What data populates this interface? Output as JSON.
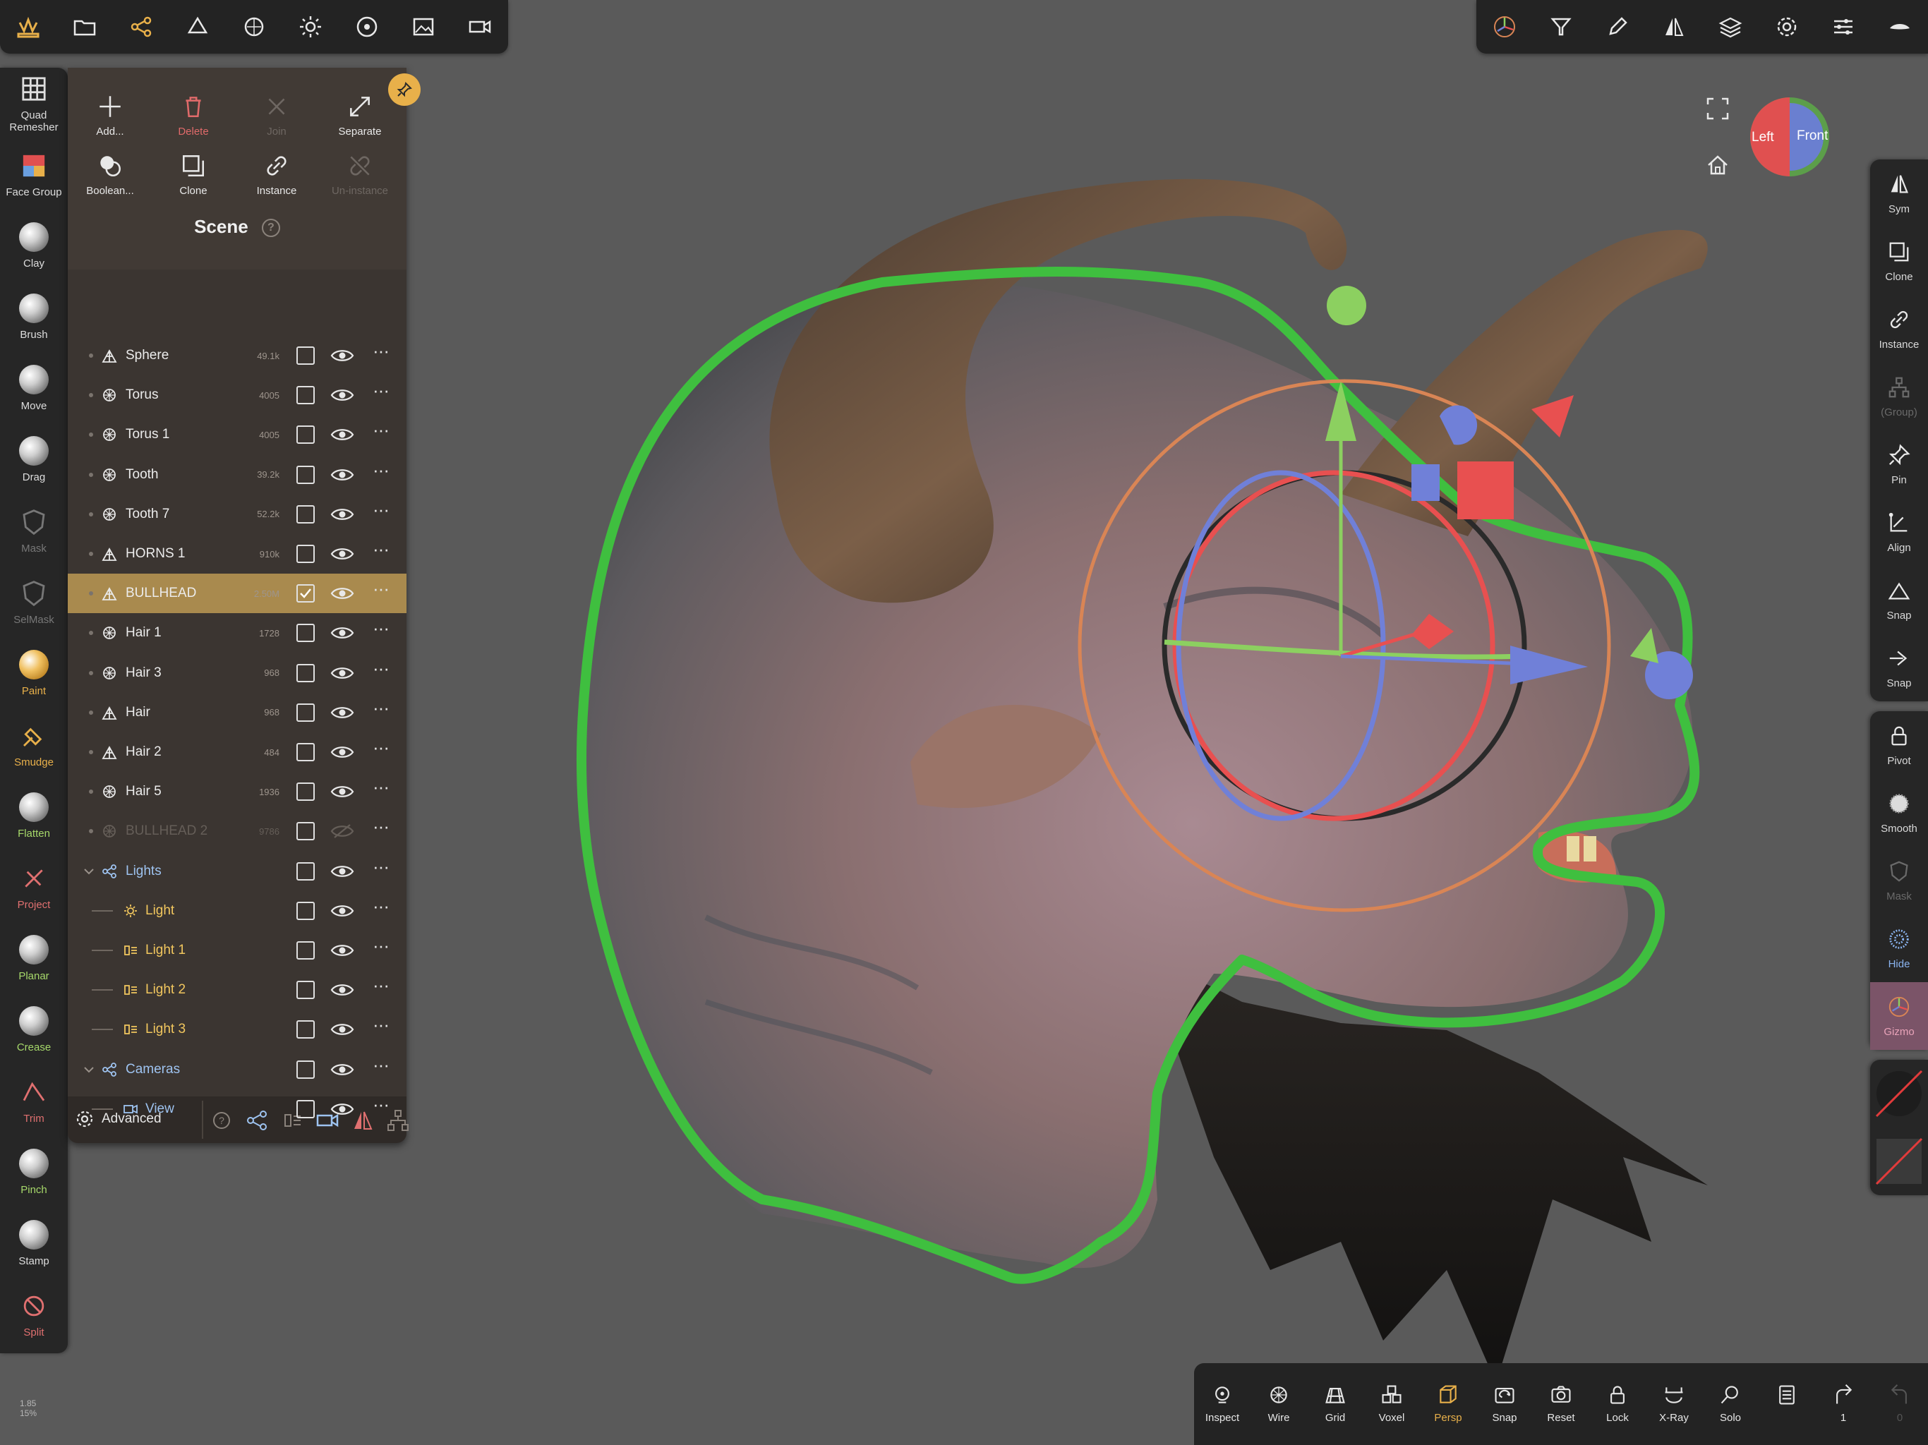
{
  "top_toolbar_left": [
    "logo-icon",
    "folder-icon",
    "scene-graph-icon",
    "shape-icon",
    "material-icon",
    "light-icon",
    "environment-icon",
    "image-icon",
    "camera-icon"
  ],
  "top_toolbar_right": [
    "gizmo-icon",
    "filter-icon",
    "pen-icon",
    "symmetry-icon",
    "layers-icon",
    "settings-icon",
    "sliders-icon",
    "hide-icon"
  ],
  "left_tools": [
    {
      "label": "Quad Remesher",
      "icon": "grid-icon",
      "color": "#dddddd"
    },
    {
      "label": "Face Group",
      "icon": "facegroup-icon",
      "color": "#dddddd"
    },
    {
      "label": "Clay",
      "icon": "ball-icon",
      "color": "#dddddd"
    },
    {
      "label": "Brush",
      "icon": "ball-icon",
      "color": "#dddddd"
    },
    {
      "label": "Move",
      "icon": "ball-icon",
      "color": "#dddddd"
    },
    {
      "label": "Drag",
      "icon": "ball-icon",
      "color": "#dddddd"
    },
    {
      "label": "Mask",
      "icon": "shield-icon",
      "color": "#777777"
    },
    {
      "label": "SelMask",
      "icon": "shield-icon",
      "color": "#777777"
    },
    {
      "label": "Paint",
      "icon": "paint-ball-icon",
      "color": "#e8b04a"
    },
    {
      "label": "Smudge",
      "icon": "smudge-icon",
      "color": "#e8b04a"
    },
    {
      "label": "Flatten",
      "icon": "ball-icon",
      "color": "#a6d86a"
    },
    {
      "label": "Project",
      "icon": "project-icon",
      "color": "#e07070"
    },
    {
      "label": "Planar",
      "icon": "ball-icon",
      "color": "#a6d86a"
    },
    {
      "label": "Crease",
      "icon": "ball-icon",
      "color": "#a6d86a"
    },
    {
      "label": "Trim",
      "icon": "trim-icon",
      "color": "#e07070"
    },
    {
      "label": "Pinch",
      "icon": "ball-icon",
      "color": "#a6d86a"
    },
    {
      "label": "Stamp",
      "icon": "ball-icon",
      "color": "#dddddd"
    },
    {
      "label": "Split",
      "icon": "split-icon",
      "color": "#e07070"
    }
  ],
  "panel": {
    "actions": [
      {
        "label": "Add...",
        "icon": "plus-icon"
      },
      {
        "label": "Delete",
        "icon": "trash-icon"
      },
      {
        "label": "Join",
        "icon": "join-icon"
      },
      {
        "label": "Separate",
        "icon": "separate-icon"
      },
      {
        "label": "Boolean...",
        "icon": "boolean-icon"
      },
      {
        "label": "Clone",
        "icon": "clone-icon"
      },
      {
        "label": "Instance",
        "icon": "link-icon"
      },
      {
        "label": "Un-instance",
        "icon": "unlink-icon"
      }
    ],
    "title": "Scene",
    "rows": [
      {
        "name": "Sphere",
        "count": "49.1k",
        "icon": "mesh-icon",
        "checked": false,
        "visible": true
      },
      {
        "name": "Torus",
        "count": "4005",
        "icon": "group-mesh-icon",
        "checked": false,
        "visible": true
      },
      {
        "name": "Torus 1",
        "count": "4005",
        "icon": "group-mesh-icon",
        "checked": false,
        "visible": true
      },
      {
        "name": "Tooth",
        "count": "39.2k",
        "icon": "group-mesh-icon",
        "checked": false,
        "visible": true
      },
      {
        "name": "Tooth 7",
        "count": "52.2k",
        "icon": "group-mesh-icon",
        "checked": false,
        "visible": true
      },
      {
        "name": "HORNS 1",
        "count": "910k",
        "icon": "mesh-icon",
        "checked": false,
        "visible": true
      },
      {
        "name": "BULLHEAD",
        "count": "2.50M",
        "icon": "mesh-icon",
        "checked": true,
        "visible": true,
        "selected": true
      },
      {
        "name": "Hair 1",
        "count": "1728",
        "icon": "group-mesh-icon",
        "checked": false,
        "visible": true
      },
      {
        "name": "Hair 3",
        "count": "968",
        "icon": "group-mesh-icon",
        "checked": false,
        "visible": true
      },
      {
        "name": "Hair",
        "count": "968",
        "icon": "mesh-icon",
        "checked": false,
        "visible": true
      },
      {
        "name": "Hair 2",
        "count": "484",
        "icon": "mesh-icon",
        "checked": false,
        "visible": true
      },
      {
        "name": "Hair 5",
        "count": "1936",
        "icon": "group-mesh-icon",
        "checked": false,
        "visible": true
      },
      {
        "name": "BULLHEAD 2",
        "count": "9786",
        "icon": "group-mesh-icon",
        "checked": false,
        "visible": false
      },
      {
        "name": "Lights",
        "count": "",
        "icon": "lights-group-icon",
        "checked": false,
        "visible": true,
        "kind": "blue",
        "expander": true
      },
      {
        "name": "Light",
        "count": "",
        "icon": "sun-icon",
        "checked": false,
        "visible": true,
        "kind": "light",
        "indent": true
      },
      {
        "name": "Light 1",
        "count": "",
        "icon": "spotlight-icon",
        "checked": false,
        "visible": true,
        "kind": "light",
        "indent": true
      },
      {
        "name": "Light 2",
        "count": "",
        "icon": "spotlight-icon",
        "checked": false,
        "visible": true,
        "kind": "light",
        "indent": true
      },
      {
        "name": "Light 3",
        "count": "",
        "icon": "spotlight-icon",
        "checked": false,
        "visible": true,
        "kind": "light",
        "indent": true
      },
      {
        "name": "Cameras",
        "count": "",
        "icon": "cameras-group-icon",
        "checked": false,
        "visible": true,
        "kind": "blue",
        "expander": true
      },
      {
        "name": "View",
        "count": "",
        "icon": "camera-icon",
        "checked": false,
        "visible": true,
        "kind": "blue",
        "indent": true
      }
    ],
    "footer": {
      "label": "Advanced",
      "icons": [
        "help-icon",
        "scene-graph-icon",
        "spotlight-icon",
        "camera-icon",
        "symmetry-icon",
        "hierarchy-icon"
      ]
    }
  },
  "viewcube": {
    "left": "Left",
    "front": "Front"
  },
  "right_tools": [
    {
      "label": "Sym",
      "icon": "symmetry-icon",
      "group": 1,
      "badge": "w"
    },
    {
      "label": "Clone",
      "icon": "clone-icon",
      "group": 1
    },
    {
      "label": "Instance",
      "icon": "link-icon",
      "group": 1
    },
    {
      "label": "(Group)",
      "icon": "hierarchy-icon",
      "group": 1,
      "dim": true
    },
    {
      "label": "Pin",
      "icon": "pin-icon",
      "group": 1
    },
    {
      "label": "Align",
      "icon": "align-icon",
      "group": 1
    },
    {
      "label": "Snap",
      "icon": "triangle-icon",
      "group": 1
    },
    {
      "label": "Snap",
      "icon": "arrow-right-icon",
      "group": 1
    },
    {
      "label": "Pivot",
      "icon": "lock-icon",
      "group": 2
    },
    {
      "label": "Smooth",
      "icon": "smooth-icon",
      "group": 2
    },
    {
      "label": "Mask",
      "icon": "shield-icon",
      "group": 2,
      "dim": true
    },
    {
      "label": "Hide",
      "icon": "hide-dots-icon",
      "group": 2,
      "color": "#8ab4f0"
    },
    {
      "label": "Gizmo",
      "icon": "gizmo-icon",
      "group": 2,
      "active": true
    }
  ],
  "bottom_tools": [
    {
      "label": "Inspect",
      "icon": "inspect-icon"
    },
    {
      "label": "Wire",
      "icon": "wire-icon"
    },
    {
      "label": "Grid",
      "icon": "grid-floor-icon"
    },
    {
      "label": "Voxel",
      "icon": "voxel-icon"
    },
    {
      "label": "Persp",
      "icon": "persp-icon",
      "active": true
    },
    {
      "label": "Snap",
      "icon": "snap-camera-icon"
    },
    {
      "label": "Reset",
      "icon": "reset-camera-icon"
    },
    {
      "label": "Lock",
      "icon": "lock-icon"
    },
    {
      "label": "X-Ray",
      "icon": "xray-icon"
    },
    {
      "label": "Solo",
      "icon": "search-icon"
    },
    {
      "label": "",
      "icon": "history-icon"
    },
    {
      "label": "1",
      "icon": "redo-icon"
    },
    {
      "label": "0",
      "icon": "undo-icon",
      "dim": true
    }
  ],
  "status": {
    "line1": "1.85",
    "line2": "15%"
  },
  "colors": {
    "accent": "#e8b04a",
    "selection": "#a98a4e",
    "outline": "#3fbf3f",
    "gizmo_x": "#e85050",
    "gizmo_y": "#8cd060",
    "gizmo_z": "#7080d8"
  }
}
